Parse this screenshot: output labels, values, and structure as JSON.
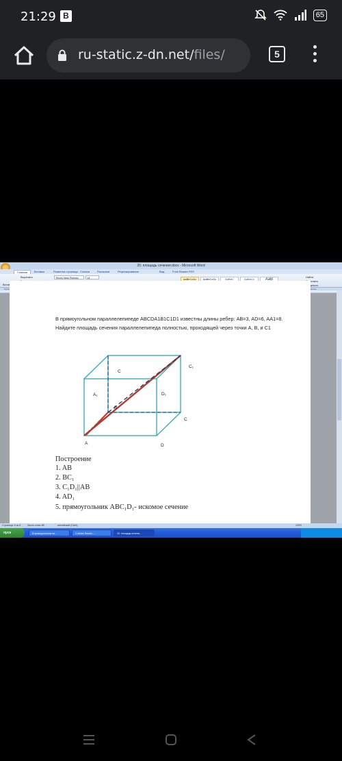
{
  "status": {
    "time": "21:29",
    "app_badge": "B",
    "battery": "65"
  },
  "browser": {
    "url_main": "ru-static.z-dn.net/",
    "url_rest": "files/",
    "tab_count": "5"
  },
  "word": {
    "title": "20. площадь сечения.docx - Microsoft Word",
    "tabs": [
      "Главная",
      "Вставка",
      "Разметка страницы",
      "Ссылки",
      "Рассылки",
      "Рецензирование",
      "Вид",
      "Foxit Reader PDF"
    ],
    "ribbon": {
      "paste": "Вставить",
      "cut": "Вырезать",
      "copy": "Копировать",
      "format": "Формат по образцу",
      "font": "Times New Roman",
      "size": "14",
      "styles": [
        "AaBbCcDc",
        "AaBbCcDc",
        "AaBbC",
        "AaBbCc",
        "AaB"
      ],
      "style_names": [
        "¶ Обычный",
        "¶ Без инте...",
        "Заголово...",
        "Заголово...",
        "Название"
      ],
      "change_styles": "Изменить стили",
      "find": "Найти",
      "replace": "Заменить",
      "select": "Выделить"
    },
    "group_labels": [
      "Буфер обмена",
      "Шрифт",
      "Абзац",
      "Стили",
      "Редактирование"
    ],
    "doc": {
      "line1": "В прямоугольном параллелепипеде ABCDA1B1C1D1 известны длины ребер: AB=3, AD=6, AA1=8.",
      "line2": "Найдите площадь сечения параллелепипеда полностью, проходящей через точки A, B, и C1",
      "labels": {
        "C1": "C₁",
        "C_top": "C",
        "A1": "A₁",
        "D1": "D₁",
        "B": "B",
        "C": "C",
        "A": "A",
        "D": "D"
      },
      "build_title": "Построение",
      "steps": [
        "1. AB",
        "2. BC₁",
        "3. C₁D₁||AB",
        "4. AD₁",
        "5. прямоугольник ABC₁D₁- искомое сечение"
      ]
    },
    "status_bar": {
      "page": "Страница: 6 из 6",
      "words": "Число слов: 88",
      "lang": "английский (США)",
      "zoom": "100%"
    },
    "taskbar": {
      "start": "пуск",
      "items": [
        "В прямоугольном па...",
        "2 Adobe Reader ...",
        "20. площадь сечени..."
      ]
    }
  }
}
